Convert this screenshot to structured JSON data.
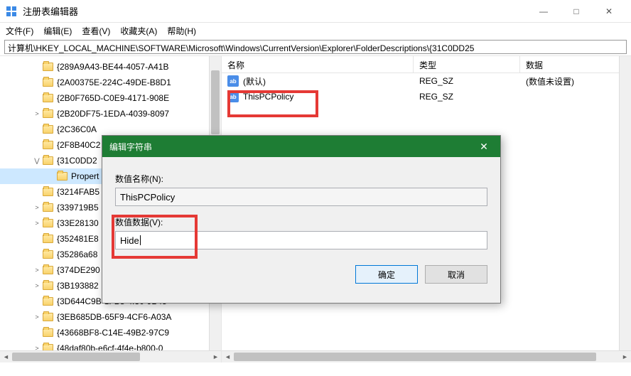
{
  "window": {
    "title": "注册表编辑器",
    "minimize": "—",
    "maximize": "□",
    "close": "✕"
  },
  "menu": {
    "file": "文件(F)",
    "edit": "编辑(E)",
    "view": "查看(V)",
    "favorites": "收藏夹(A)",
    "help": "帮助(H)"
  },
  "address": "计算机\\HKEY_LOCAL_MACHINE\\SOFTWARE\\Microsoft\\Windows\\CurrentVersion\\Explorer\\FolderDescriptions\\{31C0DD25",
  "tree": {
    "items": [
      {
        "indent": 60,
        "exp": "",
        "label": "{289A9A43-BE44-4057-A41B"
      },
      {
        "indent": 60,
        "exp": "",
        "label": "{2A00375E-224C-49DE-B8D1"
      },
      {
        "indent": 60,
        "exp": "",
        "label": "{2B0F765D-C0E9-4171-908E"
      },
      {
        "indent": 60,
        "exp": ">",
        "label": "{2B20DF75-1EDA-4039-8097"
      },
      {
        "indent": 60,
        "exp": "",
        "label": "{2C36C0A"
      },
      {
        "indent": 60,
        "exp": "",
        "label": "{2F8B40C2"
      },
      {
        "indent": 60,
        "exp": "v",
        "label": "{31C0DD2"
      },
      {
        "indent": 80,
        "exp": "",
        "label": "Propert",
        "sel": true
      },
      {
        "indent": 60,
        "exp": "",
        "label": "{3214FAB5"
      },
      {
        "indent": 60,
        "exp": ">",
        "label": "{339719B5"
      },
      {
        "indent": 60,
        "exp": ">",
        "label": "{33E28130"
      },
      {
        "indent": 60,
        "exp": "",
        "label": "{352481E8"
      },
      {
        "indent": 60,
        "exp": "",
        "label": "{35286a68"
      },
      {
        "indent": 60,
        "exp": ">",
        "label": "{374DE290"
      },
      {
        "indent": 60,
        "exp": ">",
        "label": "{3B193882"
      },
      {
        "indent": 60,
        "exp": "",
        "label": "{3D644C9B-1FB8-4f30-9B45"
      },
      {
        "indent": 60,
        "exp": ">",
        "label": "{3EB685DB-65F9-4CF6-A03A"
      },
      {
        "indent": 60,
        "exp": "",
        "label": "{43668BF8-C14E-49B2-97C9"
      },
      {
        "indent": 60,
        "exp": ">",
        "label": "{48daf80b-e6cf-4f4e-b800-0"
      }
    ]
  },
  "list": {
    "columns": {
      "name": "名称",
      "type": "类型",
      "data": "数据"
    },
    "rows": [
      {
        "name": "(默认)",
        "type": "REG_SZ",
        "data": "(数值未设置)"
      },
      {
        "name": "ThisPCPolicy",
        "type": "REG_SZ",
        "data": ""
      }
    ]
  },
  "dialog": {
    "title": "编辑字符串",
    "name_label": "数值名称(N):",
    "name_value": "ThisPCPolicy",
    "data_label": "数值数据(V):",
    "data_value": "Hide",
    "ok": "确定",
    "cancel": "取消"
  }
}
